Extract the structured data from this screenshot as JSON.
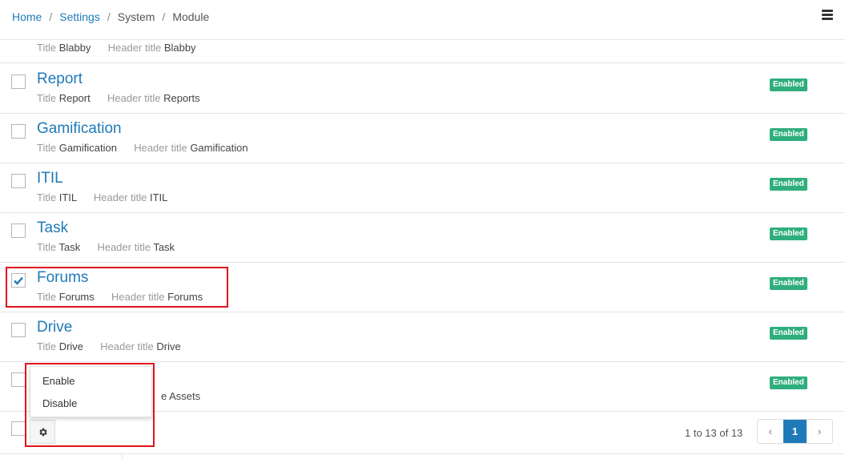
{
  "breadcrumb": {
    "home": "Home",
    "settings": "Settings",
    "system": "System",
    "module": "Module",
    "separator": "/"
  },
  "labels": {
    "title": "Title",
    "header_title": "Header title"
  },
  "partial_row": {
    "title": "Blabby",
    "header_title": "Blabby"
  },
  "modules": [
    {
      "name": "Report",
      "title": "Report",
      "header_title": "Reports",
      "status": "Enabled",
      "checked": false
    },
    {
      "name": "Gamification",
      "title": "Gamification",
      "header_title": "Gamification",
      "status": "Enabled",
      "checked": false
    },
    {
      "name": "ITIL",
      "title": "ITIL",
      "header_title": "ITIL",
      "status": "Enabled",
      "checked": false
    },
    {
      "name": "Task",
      "title": "Task",
      "header_title": "Task",
      "status": "Enabled",
      "checked": false
    },
    {
      "name": "Forums",
      "title": "Forums",
      "header_title": "Forums",
      "status": "Enabled",
      "checked": true
    },
    {
      "name": "Drive",
      "title": "Drive",
      "header_title": "Drive",
      "status": "Enabled",
      "checked": false
    },
    {
      "name": "",
      "title": "",
      "header_title": "Assets",
      "header_title_partial": "e Assets",
      "status": "Enabled",
      "checked": false
    }
  ],
  "bulk_menu": {
    "enable": "Enable",
    "disable": "Disable"
  },
  "icons": {
    "menu": "hamburger-icon",
    "gear": "gear-icon",
    "check": "checkmark-icon",
    "prev": "chevron-left-icon",
    "next": "chevron-right-icon"
  },
  "pagination": {
    "info": "1 to 13 of 13",
    "prev": "‹",
    "current": "1",
    "next": "›"
  },
  "colors": {
    "link": "#1f7ab8",
    "badge": "#2fae7d",
    "highlight": "#e0141c"
  }
}
